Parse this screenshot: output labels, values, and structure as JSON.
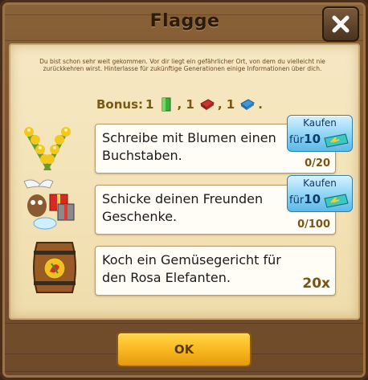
{
  "dialog": {
    "title": "Flagge",
    "intro": "Du bist schon sehr weit gekommen. Vor dir liegt ein gefährlicher Ort, von dem du vielleicht nie zurückkehren wirst. Hinterlasse für zukünftige Generationen einige Informationen über dich.",
    "close_icon": "close-icon"
  },
  "bonus": {
    "label": "Bonus:",
    "items": [
      {
        "count": "1",
        "icon": "green-material-icon",
        "color": "#3cae3a"
      },
      {
        "count": ", 1",
        "icon": "red-material-icon",
        "color": "#c8342c"
      },
      {
        "count": ", 1",
        "icon": "blue-material-icon",
        "color": "#3c98d8"
      }
    ],
    "end": "."
  },
  "tasks": [
    {
      "text": "Schreibe mit Blumen einen Buchstaben.",
      "progress": "0/20",
      "icon": "flowers-icon",
      "buy": {
        "label": "Kaufen",
        "price_prefix": "für",
        "price": "10",
        "currency_icon": "ticket-icon"
      }
    },
    {
      "text": "Schicke deinen Freunden Geschenke.",
      "progress": "0/100",
      "icon": "gifts-icon",
      "buy": {
        "label": "Kaufen",
        "price_prefix": "für",
        "price": "10",
        "currency_icon": "ticket-icon"
      }
    },
    {
      "text": "Koch ein Gemüsegericht für den Rosa Elefanten.",
      "progress": "20x",
      "icon": "barrel-icon"
    }
  ],
  "footer": {
    "ok_label": "OK"
  },
  "colors": {
    "buy_button": "#8cd4f4",
    "ok_button": "#f7b51e",
    "wood": "#7a5430",
    "parchment": "#f3e2b6"
  }
}
